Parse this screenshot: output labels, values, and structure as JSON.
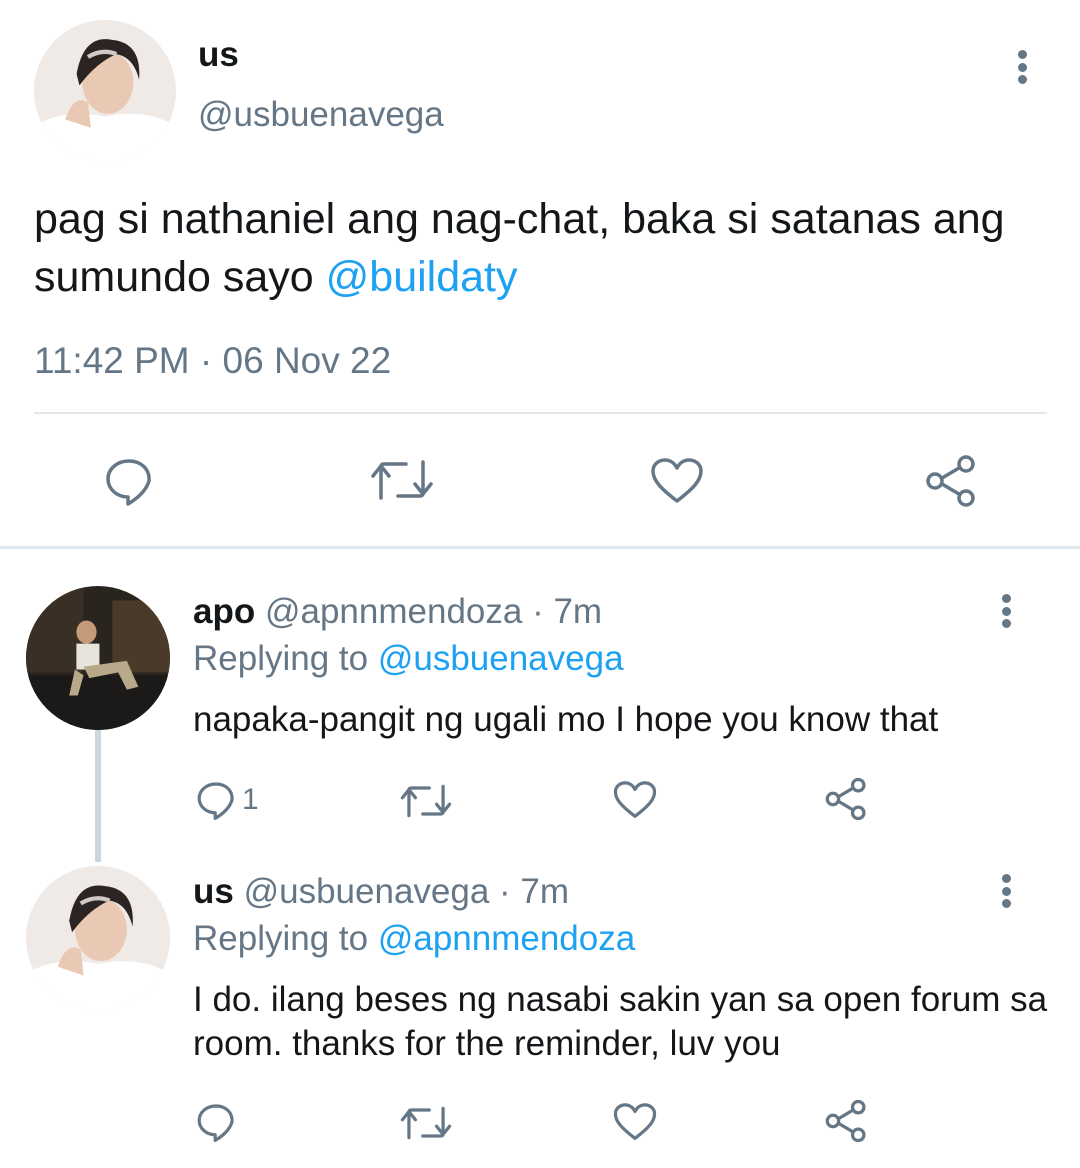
{
  "main_tweet": {
    "name": "us",
    "handle": "@usbuenavega",
    "text": "pag si nathaniel ang nag-chat, baka si satanas ang sumundo sayo ",
    "mention": "@buildaty",
    "timestamp": "11:42 PM · 06 Nov 22"
  },
  "replies": [
    {
      "name": "apo",
      "handle": "@apnnmendoza",
      "time": " · 7m",
      "replying_label": "Replying to ",
      "replying_to": "@usbuenavega",
      "text": "napaka-pangit ng ugali mo I hope you know that",
      "reply_count": "1"
    },
    {
      "name": "us",
      "handle": "@usbuenavega",
      "time": " · 7m",
      "replying_label": "Replying to ",
      "replying_to": "@apnnmendoza",
      "text": "I do. ilang beses ng nasabi sakin yan sa open forum sa room. thanks for the reminder, luv you",
      "reply_count": ""
    }
  ],
  "icons": {
    "reply": "reply-icon",
    "retweet": "retweet-icon",
    "like": "heart-icon",
    "share": "share-icon",
    "more": "more-vertical-icon"
  },
  "colors": {
    "link": "#1da1f2",
    "secondary_text": "#657786",
    "divider": "#e1e8ed"
  }
}
